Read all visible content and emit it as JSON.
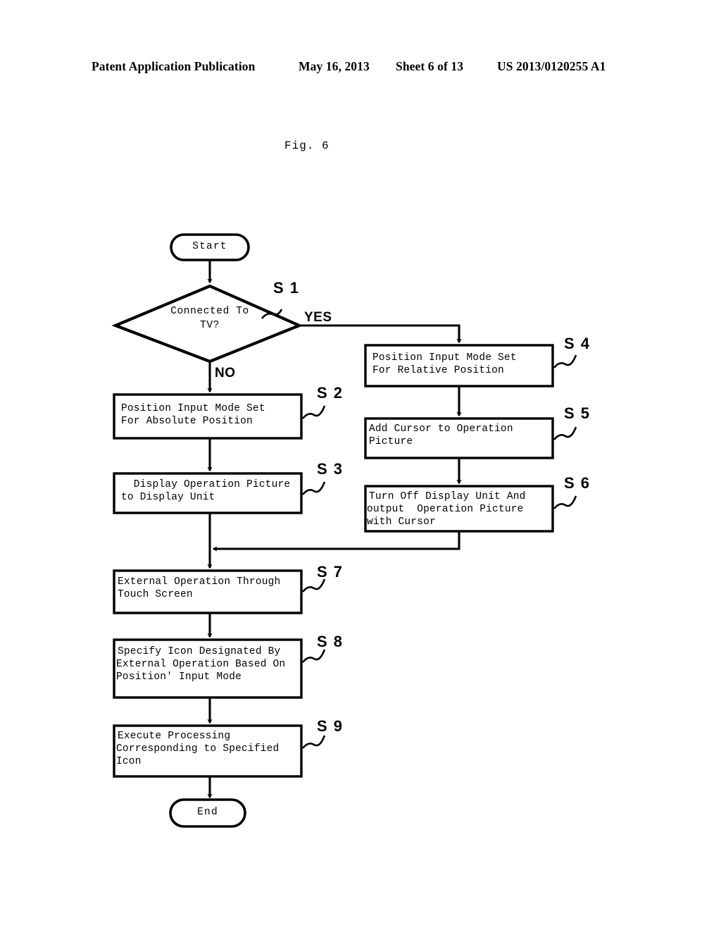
{
  "header": {
    "publication": "Patent Application Publication",
    "date": "May 16, 2013",
    "sheet": "Sheet 6 of 13",
    "patent_number": "US 2013/0120255 A1"
  },
  "figure": {
    "caption": "Fig. 6"
  },
  "chart_data": {
    "type": "diagram",
    "diagram_kind": "flowchart",
    "title": "Fig. 6",
    "nodes": [
      {
        "id": "start",
        "shape": "terminal",
        "label": "Start",
        "step": null
      },
      {
        "id": "s1",
        "shape": "decision",
        "label": "Connected To\nTV?",
        "step": "S 1"
      },
      {
        "id": "s2",
        "shape": "process",
        "label": "Position Input Mode Set\nFor Absolute Position",
        "step": "S 2"
      },
      {
        "id": "s3",
        "shape": "process",
        "label": "Display Operation Picture\nto Display Unit",
        "step": "S 3"
      },
      {
        "id": "s4",
        "shape": "process",
        "label": "Position Input Mode Set\nFor Relative Position",
        "step": "S 4"
      },
      {
        "id": "s5",
        "shape": "process",
        "label": "Add Cursor to Operation\nPicture",
        "step": "S 5"
      },
      {
        "id": "s6",
        "shape": "process",
        "label": "Turn Off Display Unit And\noutput  Operation Picture\nwith Cursor",
        "step": "S 6"
      },
      {
        "id": "s7",
        "shape": "process",
        "label": "External Operation Through\nTouch Screen",
        "step": "S 7"
      },
      {
        "id": "s8",
        "shape": "process",
        "label": "Specify Icon Designated By\nExternal Operation Based On\nPosition' Input Mode",
        "step": "S 8"
      },
      {
        "id": "s9",
        "shape": "process",
        "label": "Execute Processing\nCorresponding to Specified\nIcon",
        "step": "S 9"
      },
      {
        "id": "end",
        "shape": "terminal",
        "label": "End",
        "step": null
      }
    ],
    "edges": [
      {
        "from": "start",
        "to": "s1",
        "label": ""
      },
      {
        "from": "s1",
        "to": "s2",
        "label": "NO"
      },
      {
        "from": "s1",
        "to": "s4",
        "label": "YES"
      },
      {
        "from": "s2",
        "to": "s3",
        "label": ""
      },
      {
        "from": "s3",
        "to": "s7",
        "label": ""
      },
      {
        "from": "s4",
        "to": "s5",
        "label": ""
      },
      {
        "from": "s5",
        "to": "s6",
        "label": ""
      },
      {
        "from": "s6",
        "to": "s7",
        "label": ""
      },
      {
        "from": "s7",
        "to": "s8",
        "label": ""
      },
      {
        "from": "s8",
        "to": "s9",
        "label": ""
      },
      {
        "from": "s9",
        "to": "end",
        "label": ""
      }
    ],
    "branch_labels": {
      "yes": "YES",
      "no": "NO"
    },
    "step_labels": [
      "S 1",
      "S 2",
      "S 3",
      "S 4",
      "S 5",
      "S 6",
      "S 7",
      "S 8",
      "S 9"
    ]
  },
  "flow": {
    "start": {
      "label": "Start"
    },
    "end": {
      "label": "End"
    },
    "s1": {
      "line1": "Connected To",
      "line2": "TV?",
      "step": "S 1"
    },
    "s2": {
      "line1": "Position Input Mode Set",
      "line2": "For Absolute Position",
      "step": "S 2"
    },
    "s3": {
      "line1": "  Display Operation Picture",
      "line2": "to Display Unit",
      "step": "S 3"
    },
    "s4": {
      "line1": "Position Input Mode Set",
      "line2": "For Relative Position",
      "step": "S 4"
    },
    "s5": {
      "line1": "Add Cursor to Operation",
      "line2": "Picture",
      "step": "S 5"
    },
    "s6": {
      "line1": "Turn Off Display Unit And",
      "line2": "output  Operation Picture",
      "line3": "with Cursor",
      "step": "S 6"
    },
    "s7": {
      "line1": "External Operation Through",
      "line2": "Touch Screen",
      "step": "S 7"
    },
    "s8": {
      "line1": "Specify Icon Designated By",
      "line2": "External Operation Based On",
      "line3": "Position' Input Mode",
      "step": "S 8"
    },
    "s9": {
      "line1": "Execute Processing",
      "line2": "Corresponding to Specified",
      "line3": "Icon",
      "step": "S 9"
    },
    "yes": "YES",
    "no": "NO"
  },
  "colors": {
    "ink": "#000000",
    "paper": "#ffffff"
  }
}
